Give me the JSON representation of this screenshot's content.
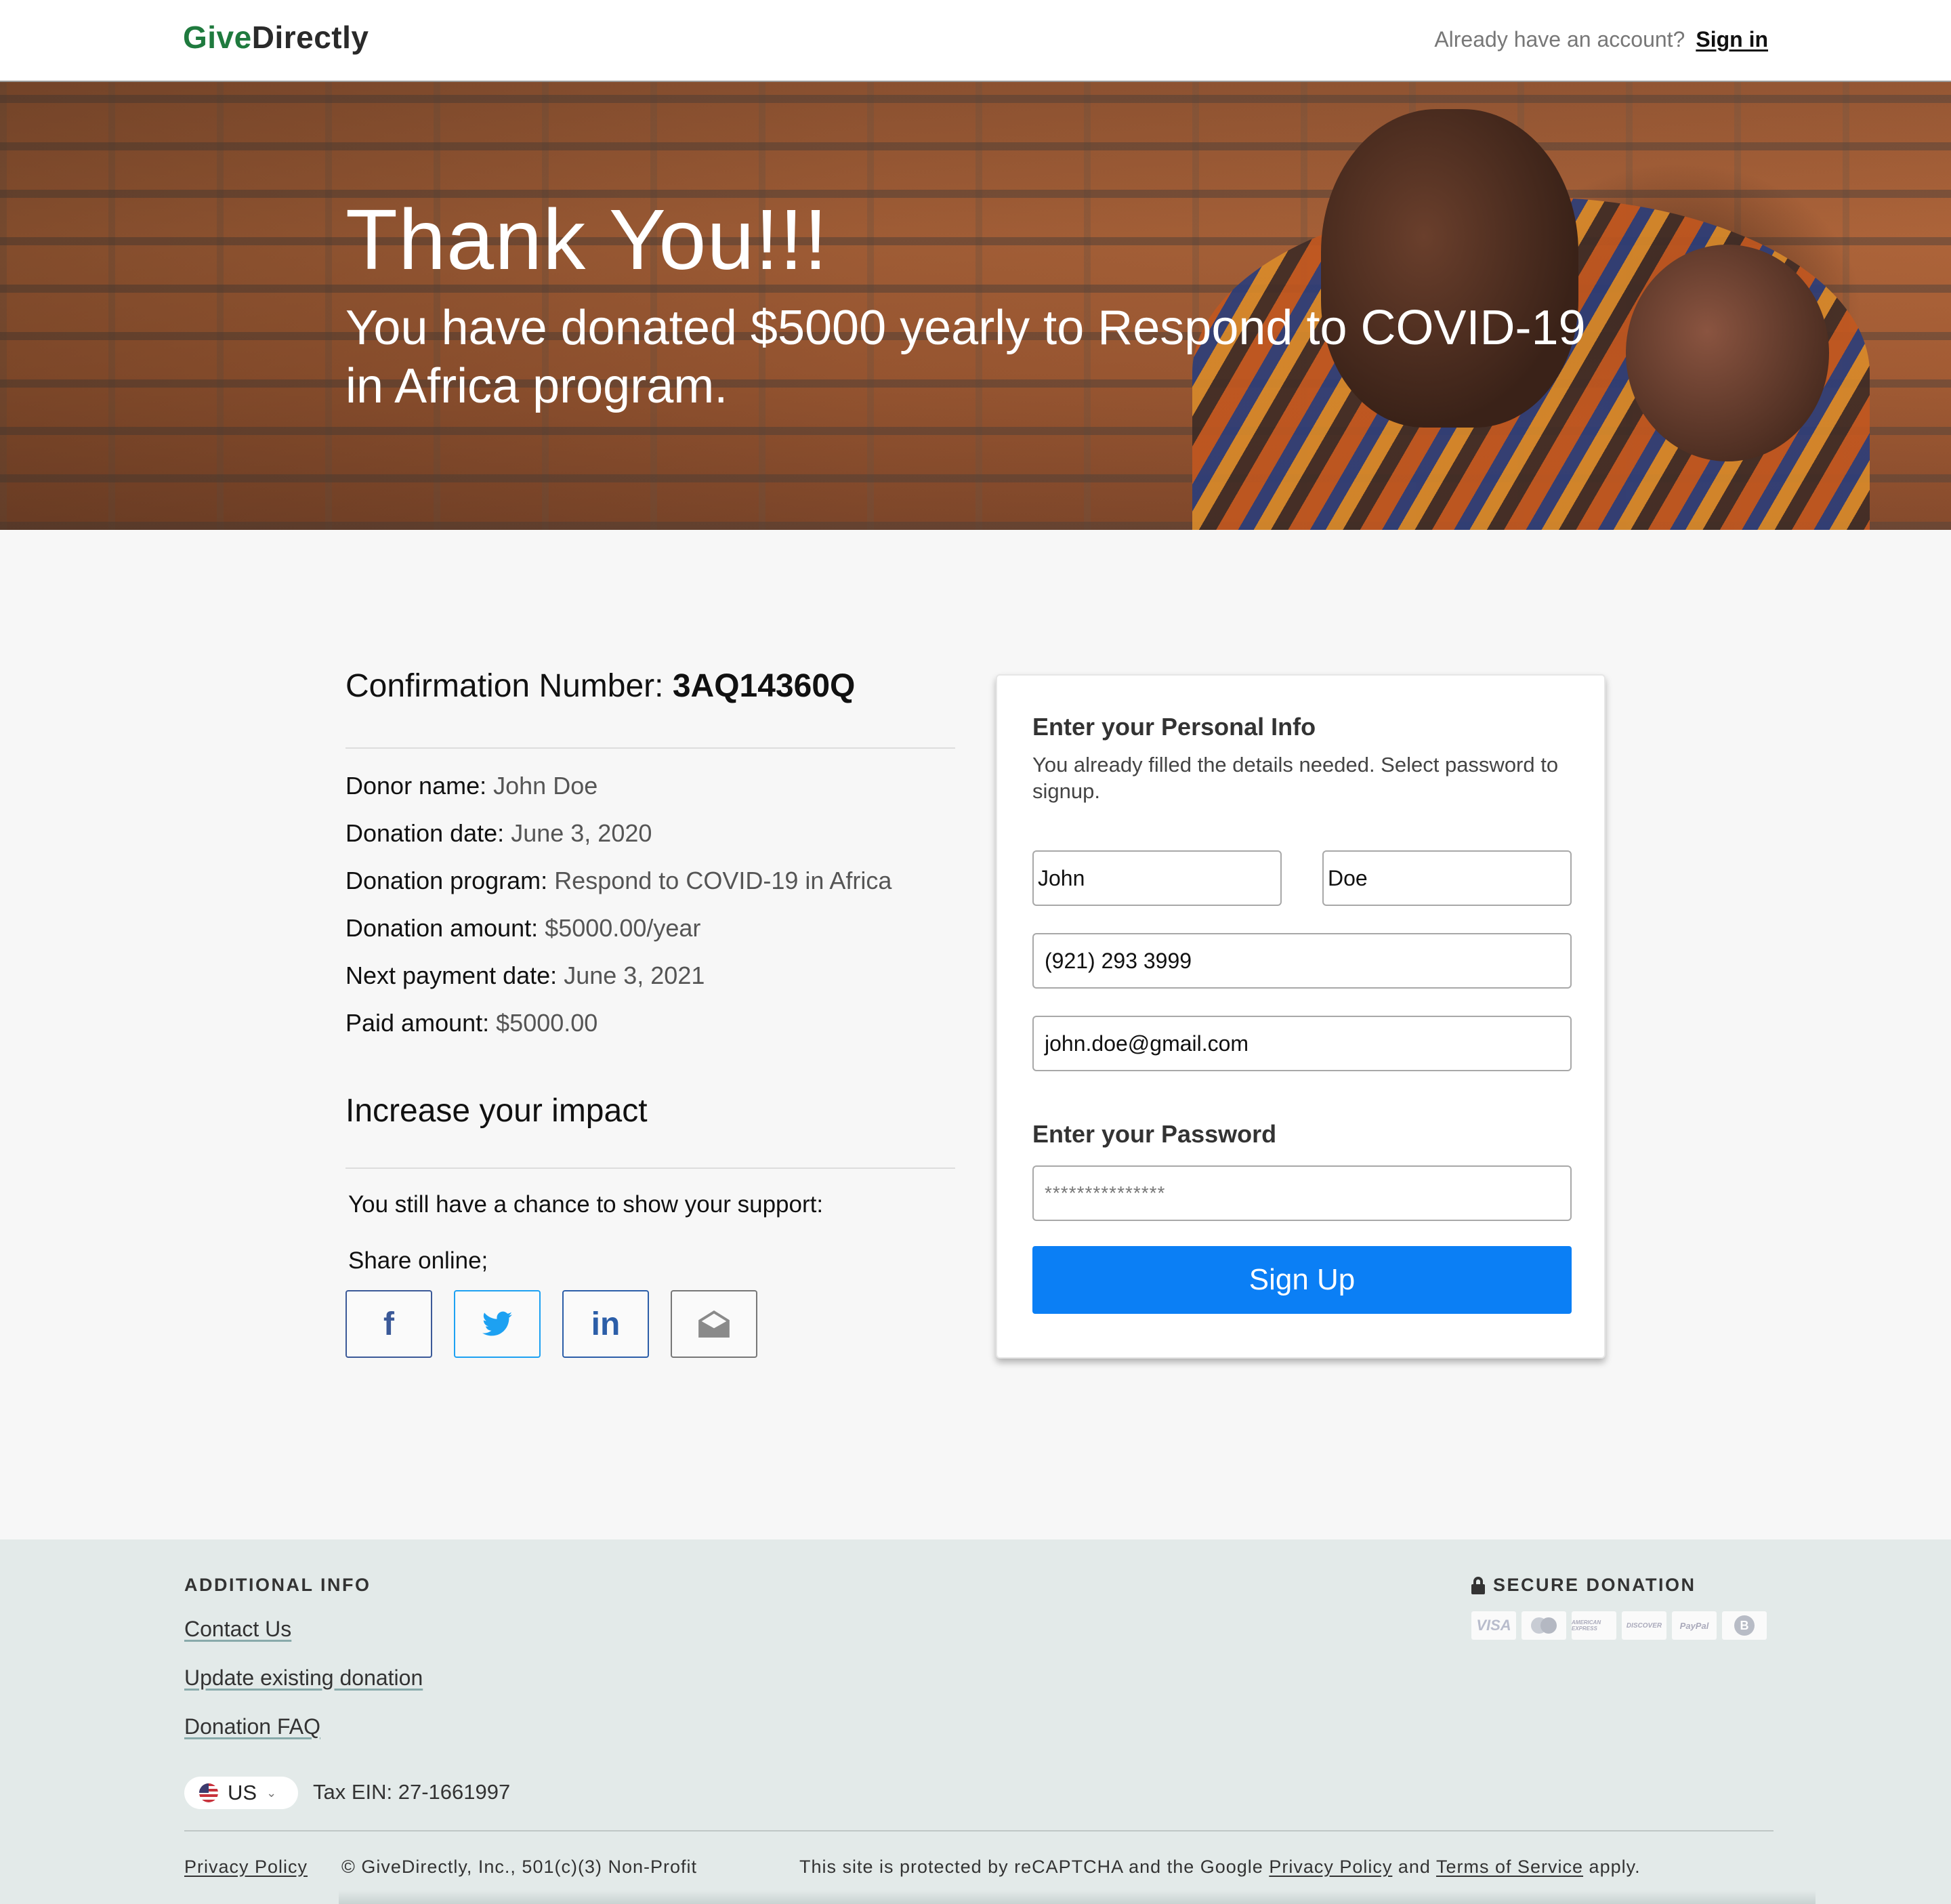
{
  "header": {
    "logo_part1": "Give",
    "logo_part2": "Directly",
    "account_prompt": "Already have an account?",
    "sign_in": "Sign in"
  },
  "hero": {
    "title": "Thank You!!!",
    "subtitle": "You have donated $5000 yearly to Respond to COVID-19 in Africa program."
  },
  "confirmation": {
    "label": "Confirmation Number:",
    "number": "3AQ14360Q"
  },
  "details": [
    {
      "label": "Donor name:",
      "value": "John Doe"
    },
    {
      "label": "Donation date:",
      "value": "June 3, 2020"
    },
    {
      "label": "Donation program:",
      "value": "Respond to COVID-19 in Africa"
    },
    {
      "label": "Donation amount:",
      "value": "$5000.00/year"
    },
    {
      "label": "Next payment date:",
      "value": "June 3, 2021"
    },
    {
      "label": "Paid amount:",
      "value": "$5000.00"
    }
  ],
  "impact": {
    "title": "Increase your impact",
    "chance_text": "You still have a chance to show your support:",
    "share_text": "Share online;",
    "socials": [
      {
        "icon": "facebook-icon",
        "glyph": "f",
        "color": "#3b5998"
      },
      {
        "icon": "twitter-icon",
        "glyph": "🐦",
        "color": "#1da1f2"
      },
      {
        "icon": "linkedin-icon",
        "glyph": "in",
        "color": "#2c5ea8"
      },
      {
        "icon": "email-icon",
        "glyph": "✉",
        "color": "#777777"
      }
    ]
  },
  "form": {
    "title": "Enter your Personal Info",
    "description": "You already filled the details needed. Select password to signup.",
    "first_name": "John",
    "last_name": "Doe",
    "phone": "(921) 293 3999",
    "email": "john.doe@gmail.com",
    "password_title": "Enter your Password",
    "password_value": "***************",
    "submit": "Sign Up",
    "accent_color": "#0b7ff5"
  },
  "footer": {
    "additional_info": "ADDITIONAL INFO",
    "links": [
      "Contact Us",
      "Update existing donation",
      "Donation FAQ"
    ],
    "secure_label": "SECURE DONATION",
    "payment_icons": [
      "visa-icon",
      "mastercard-icon",
      "amex-icon",
      "discover-icon",
      "paypal-icon",
      "bitcoin-icon"
    ],
    "payment_labels": [
      "VISA",
      "MasterCard",
      "AMERICAN EXPRESS",
      "DISCOVER",
      "PayPal",
      "B"
    ],
    "country": "US",
    "tax": "Tax EIN: 27-1661997",
    "privacy": "Privacy Policy",
    "copyright": "© GiveDirectly, Inc., 501(c)(3) Non-Profit",
    "recaptcha_prefix": "This site is protected by reCAPTCHA and the Google",
    "recaptcha_privacy": "Privacy Policy",
    "recaptcha_and": "and",
    "recaptcha_terms": "Terms of Service",
    "recaptcha_suffix": "apply."
  }
}
